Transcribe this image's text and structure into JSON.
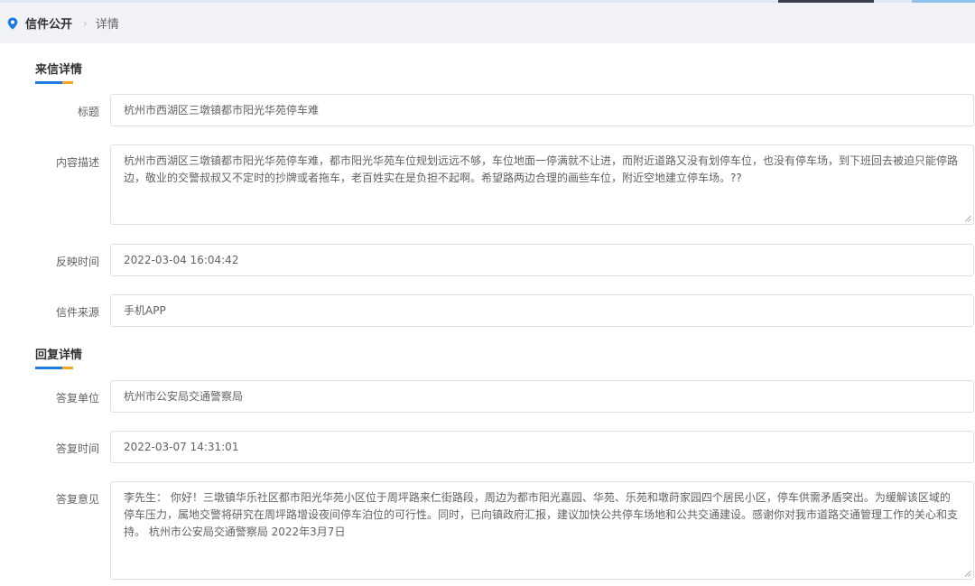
{
  "breadcrumb": {
    "root": "信件公开",
    "current": "详情"
  },
  "letter_section": {
    "title": "来信详情",
    "fields": {
      "title": {
        "label": "标题",
        "value": "杭州市西湖区三墩镇都市阳光华苑停车难"
      },
      "content": {
        "label": "内容描述",
        "value": "杭州市西湖区三墩镇都市阳光华苑停车难，都市阳光华苑车位规划远远不够，车位地面一停满就不让进，而附近道路又没有划停车位，也没有停车场，到下班回去被迫只能停路边，敬业的交警叔叔又不定时的抄牌或者拖车，老百姓实在是负担不起啊。希望路两边合理的画些车位，附近空地建立停车场。??"
      },
      "time": {
        "label": "反映时间",
        "value": "2022-03-04 16:04:42"
      },
      "source": {
        "label": "信件来源",
        "value": "手机APP"
      }
    }
  },
  "reply_section": {
    "title": "回复详情",
    "fields": {
      "unit": {
        "label": "答复单位",
        "value": "杭州市公安局交通警察局"
      },
      "time": {
        "label": "答复时间",
        "value": "2022-03-07 14:31:01"
      },
      "opinion": {
        "label": "答复意见",
        "value": "李先生： 你好！三墩镇华乐社区都市阳光华苑小区位于周坪路来仁街路段，周边为都市阳光嘉园、华苑、乐苑和墩莳家园四个居民小区，停车供需矛盾突出。为缓解该区域的停车压力，属地交警将研究在周坪路增设夜间停车泊位的可行性。同时，已向镇政府汇报，建议加快公共停车场地和公共交通建设。感谢你对我市道路交通管理工作的关心和支持。 杭州市公安局交通警察局 2022年3月7日"
      }
    }
  },
  "colors": {
    "accent_blue": "#1f7ae0",
    "accent_orange": "#f5a623",
    "border": "#dcdfe6"
  },
  "icons": {
    "breadcrumb": "location-pin-icon",
    "textarea": "resize-grip-icon"
  }
}
